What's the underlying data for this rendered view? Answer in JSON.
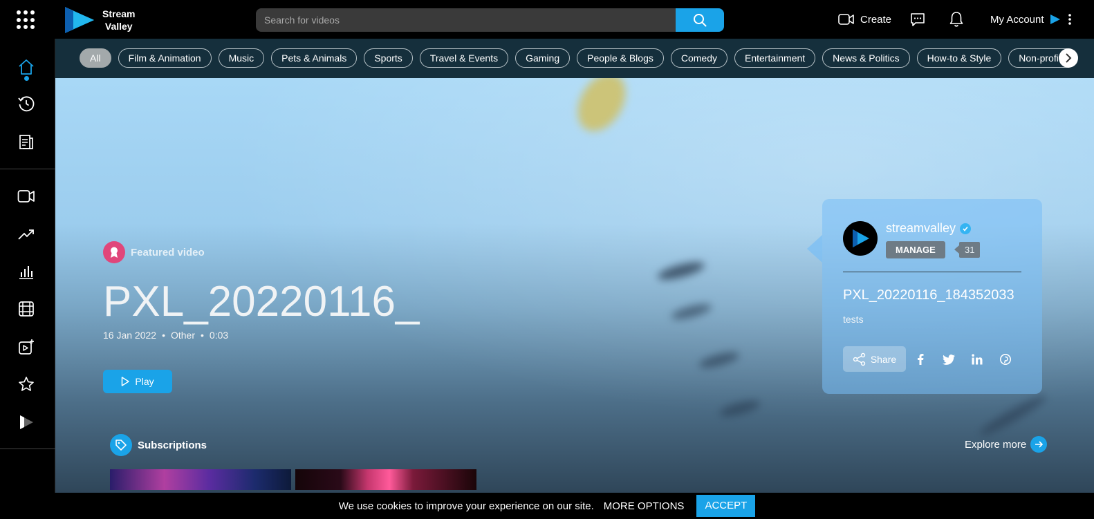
{
  "header": {
    "logo_line1": "Stream",
    "logo_line2": "Valley",
    "search_placeholder": "Search for videos",
    "create_label": "Create",
    "account_label": "My Account"
  },
  "categories": [
    "All",
    "Film & Animation",
    "Music",
    "Pets & Animals",
    "Sports",
    "Travel & Events",
    "Gaming",
    "People & Blogs",
    "Comedy",
    "Entertainment",
    "News & Politics",
    "How-to & Style",
    "Non-profits"
  ],
  "sidebar": {
    "icons": [
      "home-icon",
      "history-icon",
      "playlist-icon",
      "video-camera-icon",
      "trending-icon",
      "stats-icon",
      "film-icon",
      "add-video-icon",
      "star-icon",
      "play-stack-icon"
    ]
  },
  "hero": {
    "featured_label": "Featured video",
    "title": "PXL_20220116_",
    "date": "16 Jan 2022",
    "category": "Other",
    "duration": "0:03",
    "separator": "•",
    "play_label": "Play"
  },
  "card": {
    "channel": "streamvalley",
    "manage_label": "MANAGE",
    "subscriber_count": "31",
    "video_title": "PXL_20220116_184352033",
    "description": "tests",
    "share_label": "Share"
  },
  "subscriptions": {
    "label": "Subscriptions",
    "explore_label": "Explore more"
  },
  "cookie": {
    "text": "We use cookies to improve your experience on our site.",
    "more_label": "MORE OPTIONS",
    "accept_label": "ACCEPT"
  },
  "colors": {
    "accent": "#1aa3e8",
    "featured_badge": "#e0467a",
    "category_bar": "#152f3c"
  }
}
